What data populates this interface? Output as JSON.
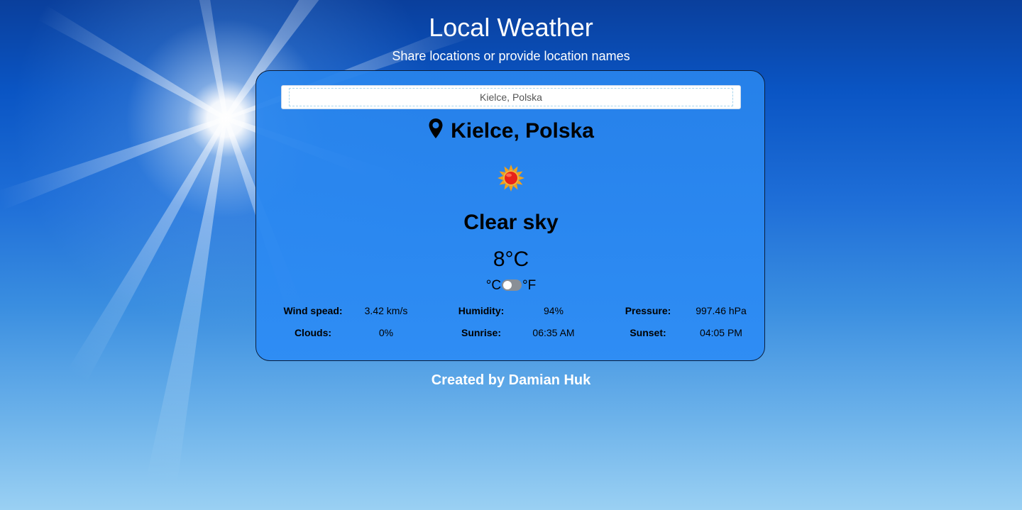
{
  "header": {
    "title": "Local Weather",
    "subtitle": "Share locations or provide location names"
  },
  "search": {
    "value": "Kielce, Polska"
  },
  "weather": {
    "location": "Kielce, Polska",
    "icon": "sun-icon",
    "condition": "Clear sky",
    "temperature": "8°C",
    "unit_celsius": "°C",
    "unit_fahrenheit": "°F",
    "unit_selected": "C"
  },
  "stats": {
    "wind_label": "Wind spead:",
    "wind_value": "3.42 km/s",
    "humidity_label": "Humidity:",
    "humidity_value": "94%",
    "pressure_label": "Pressure:",
    "pressure_value": "997.46 hPa",
    "clouds_label": "Clouds:",
    "clouds_value": "0%",
    "sunrise_label": "Sunrise:",
    "sunrise_value": "06:35 AM",
    "sunset_label": "Sunset:",
    "sunset_value": "04:05 PM"
  },
  "footer": {
    "credit": "Created by Damian Huk"
  },
  "colors": {
    "card": "#2d8cf5",
    "sky_top": "#0a3f9c",
    "sky_bottom": "#9ad0f3"
  }
}
